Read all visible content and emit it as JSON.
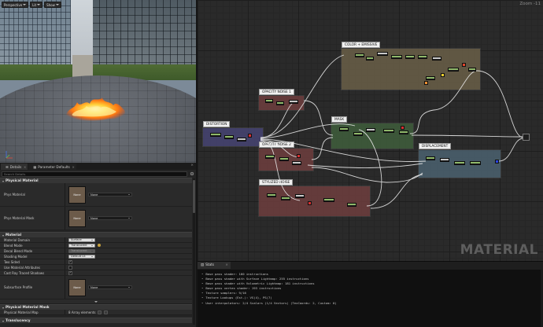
{
  "viewport": {
    "toolbar": [
      {
        "label": "Perspective"
      },
      {
        "label": "Lit"
      },
      {
        "label": "Show"
      }
    ],
    "axis_labels": {
      "x": "X",
      "y": "Y",
      "z": "Z"
    }
  },
  "details_panel": {
    "tabs": [
      {
        "label": "Details",
        "icon": "details-icon"
      },
      {
        "label": "Parameter Defaults",
        "icon": "parameter-icon"
      }
    ],
    "search_placeholder": "Search Details",
    "categories": {
      "physical_material": {
        "title": "Physical Material",
        "rows": [
          {
            "label": "Phys Material",
            "thumb_text": "None",
            "value": "None"
          },
          {
            "label": "Phys Material Mask",
            "thumb_text": "None",
            "value": "None"
          }
        ]
      },
      "material": {
        "title": "Material",
        "rows": {
          "domain": {
            "label": "Material Domain",
            "value": "Surface"
          },
          "blend": {
            "label": "Blend Mode",
            "value": "Translucent"
          },
          "decal": {
            "label": "Decal Blend Mode",
            "value": "Translucent"
          },
          "shading": {
            "label": "Shading Model",
            "value": "Default Lit"
          },
          "two_sided": {
            "label": "Two Sided",
            "checked": "✓"
          },
          "use_attr": {
            "label": "Use Material Attributes",
            "checked": ""
          },
          "cast_ray": {
            "label": "Cast Ray Traced Shadows",
            "checked": "✓"
          },
          "subsurface": {
            "label": "Subsurface Profile",
            "thumb_text": "None",
            "value": "None"
          }
        }
      },
      "physical_material_mask": {
        "title": "Physical Material Mask",
        "rows": [
          {
            "label": "Physical Material Map",
            "value": "8 Array elements"
          }
        ]
      },
      "translucency": {
        "title": "Translucency"
      }
    }
  },
  "graph": {
    "zoom": "Zoom -11",
    "watermark": "MATERIAL",
    "comments": {
      "color_emissive": {
        "title": "COLOR + EMISSIVE",
        "color": "#6a5f48"
      },
      "opacity_noise_1": {
        "title": "OPACITY NOISE 1",
        "color": "#6e3e3e"
      },
      "distortion": {
        "title": "DISTORTION",
        "color": "#474473"
      },
      "opacity_noise_2": {
        "title": "OPACITY NOISE 2",
        "color": "#6e3e3e"
      },
      "mask": {
        "title": "MASK",
        "color": "#3f5e3c"
      },
      "displacement": {
        "title": "DISPLACEMENT",
        "color": "#4b6170"
      },
      "stylized_noise": {
        "title": "STYLIZED NOISE",
        "color": "#6e3e3e"
      }
    }
  },
  "stats": {
    "tab_label": "Stats",
    "lines": [
      "Base pass shader: 160 instructions",
      "Base pass shader with Surface Lightmap: 255 instructions",
      "Base pass shader with Volumetric Lightmap: 181 instructions",
      "Base pass vertex shader: 193 instructions",
      "Texture samplers: 9/16",
      "Texture Lookups (Est.): VS(4), PS(7)",
      "User interpolators: 2/4 Scalars (1/4 Vectors) (TexCoords: 2, Custom: 0)"
    ]
  }
}
